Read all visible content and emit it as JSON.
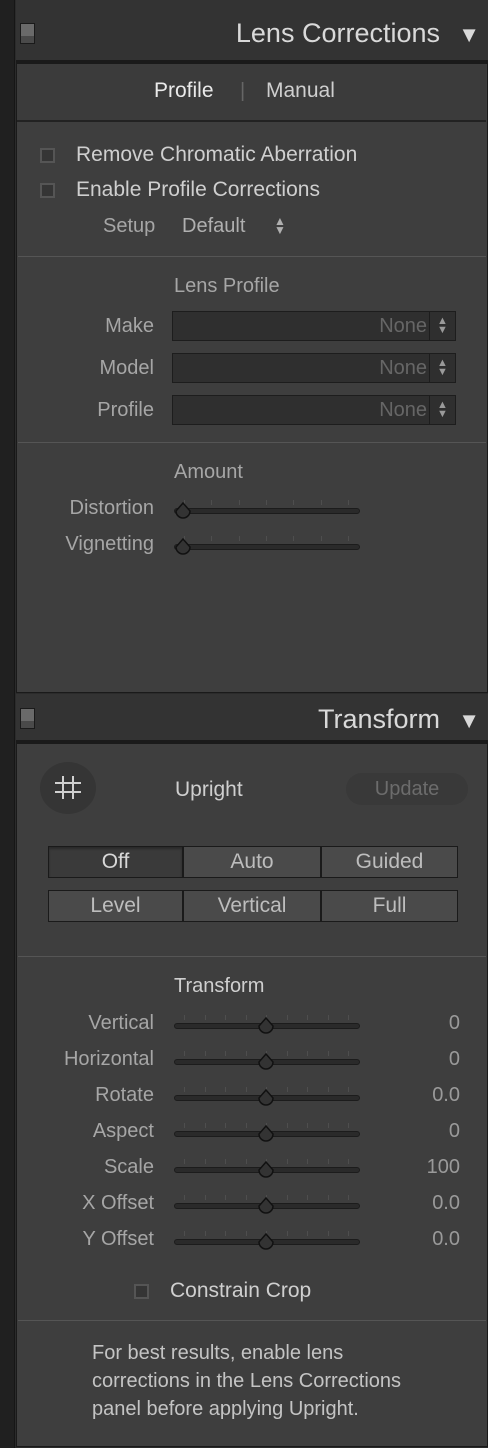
{
  "lens": {
    "title": "Lens Corrections",
    "tab_profile": "Profile",
    "tab_sep": "|",
    "tab_manual": "Manual",
    "remove_ca": "Remove Chromatic Aberration",
    "enable_profile": "Enable Profile Corrections",
    "setup_label": "Setup",
    "setup_value": "Default",
    "lens_profile_heading": "Lens Profile",
    "make_label": "Make",
    "make_value": "None",
    "model_label": "Model",
    "model_value": "None",
    "profile_label": "Profile",
    "profile_value": "None",
    "amount_heading": "Amount",
    "distortion_label": "Distortion",
    "distortion_level": 0,
    "vignetting_label": "Vignetting",
    "vignetting_level": 0
  },
  "transform": {
    "title": "Transform",
    "upright_label": "Upright",
    "update_button": "Update",
    "modes_row1": [
      "Off",
      "Auto",
      "Guided"
    ],
    "modes_row2": [
      "Level",
      "Vertical",
      "Full"
    ],
    "selected_mode": "Off",
    "section_heading": "Transform",
    "sliders": [
      {
        "label": "Vertical",
        "value": "0"
      },
      {
        "label": "Horizontal",
        "value": "0"
      },
      {
        "label": "Rotate",
        "value": "0.0"
      },
      {
        "label": "Aspect",
        "value": "0"
      },
      {
        "label": "Scale",
        "value": "100"
      },
      {
        "label": "X Offset",
        "value": "0.0"
      },
      {
        "label": "Y Offset",
        "value": "0.0"
      }
    ],
    "constrain_crop": "Constrain Crop",
    "hint_line1": "For best results, enable lens",
    "hint_line2": "corrections in the Lens Corrections",
    "hint_line3": "panel before applying Upright."
  },
  "icons": {
    "collapse": "triangle-down",
    "upright_tool": "crop-grid-icon"
  }
}
